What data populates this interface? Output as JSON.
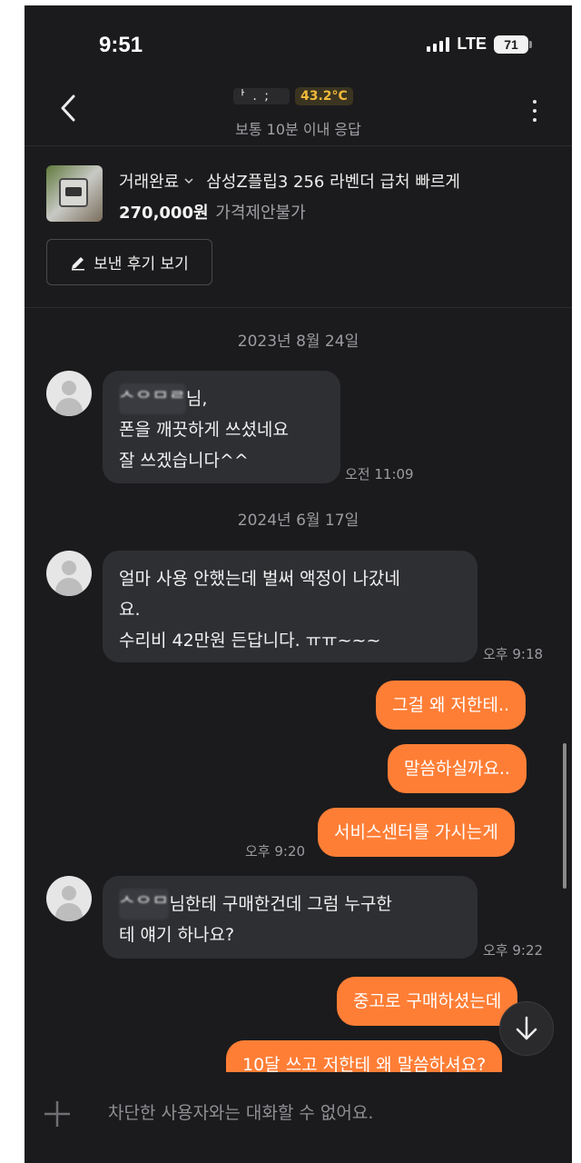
{
  "status_bar": {
    "time": "9:51",
    "network": "LTE",
    "battery": "71"
  },
  "header": {
    "name_masked": "ᅡ .  ;",
    "temperature": "43.2°C",
    "response_time": "보통 10분 이내 응답"
  },
  "product": {
    "status": "거래완료",
    "title": "삼성Z플립3 256 라벤더 급처 빠르게",
    "price": "270,000원",
    "price_note": "가격제안불가",
    "review_button": "보낸 후기 보기"
  },
  "messages": {
    "date1": "2023년 8월 24일",
    "m1_name_masked": "ᄉᄋᄆᄅ",
    "m1_text_first": "님,",
    "m1_text_rest": "폰을 깨끗하게 쓰셨네요\n잘 쓰겠습니다^^",
    "m1_time": "오전 11:09",
    "date2": "2024년 6월 17일",
    "m2_text": "얼마 사용 안했는데 벌써 액정이 나갔네\n요.\n수리비 42만원 든답니다. ㅠㅠ~~~",
    "m2_time": "오후 9:18",
    "m3_text": "그걸 왜 저한테..",
    "m4_text": "말씀하실까요..",
    "m5_text": "서비스센터를 가시는게",
    "m5_time": "오후 9:20",
    "m6_name_masked": "ᄉᄋᄆ",
    "m6_text_first": "님한테 구매한건데 그럼 누구한",
    "m6_text_rest": "테 얘기 하나요?",
    "m6_time": "오후 9:22",
    "m7_text": "중고로 구매하셨는데",
    "m8_text": "10달 쓰고 저한테 왜 말씀하셔요?"
  },
  "input": {
    "placeholder": "차단한 사용자와는 대화할 수 없어요."
  },
  "colors": {
    "accent": "#ff7e36",
    "background": "#1b1b1d",
    "bubble_in": "#2e2f33",
    "temperature": "#f0b93a"
  }
}
